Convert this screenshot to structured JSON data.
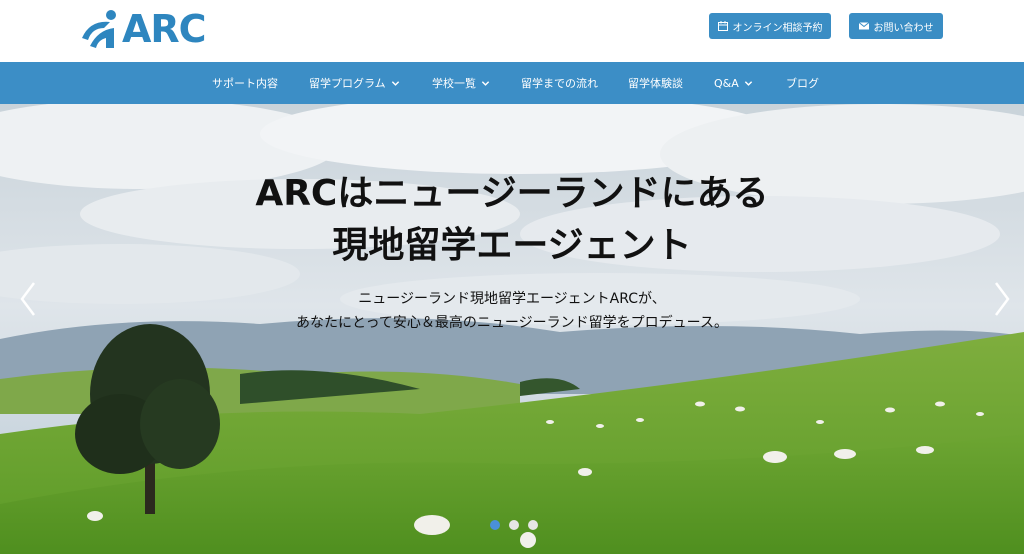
{
  "brand": {
    "logo_text": "ARC"
  },
  "header": {
    "reserve_label": "オンライン相談予約",
    "contact_label": "お問い合わせ"
  },
  "nav": {
    "items": [
      {
        "label": "サポート内容",
        "has_dropdown": false
      },
      {
        "label": "留学プログラム",
        "has_dropdown": true
      },
      {
        "label": "学校一覧",
        "has_dropdown": true
      },
      {
        "label": "留学までの流れ",
        "has_dropdown": false
      },
      {
        "label": "留学体験談",
        "has_dropdown": false
      },
      {
        "label": "Q&A",
        "has_dropdown": true
      },
      {
        "label": "ブログ",
        "has_dropdown": false
      }
    ]
  },
  "hero": {
    "title_line1": "ARCはニュージーランドにある",
    "title_line2": "現地留学エージェント",
    "subtitle_line1": "ニュージーランド現地留学エージェントARCが、",
    "subtitle_line2": "あなたにとって安心＆最高のニュージーランド留学をプロデュース。",
    "slides_total": 3,
    "active_slide": 1
  },
  "colors": {
    "brand_blue": "#3c8ec6",
    "button_blue": "#3a8dc4",
    "dot_active": "#4a90d9",
    "dot_inactive": "#e6e6e6"
  },
  "icons": {
    "reserve": "calendar-icon",
    "contact": "envelope-icon",
    "dropdown": "chevron-down-icon",
    "prev": "chevron-left-icon",
    "next": "chevron-right-icon"
  }
}
